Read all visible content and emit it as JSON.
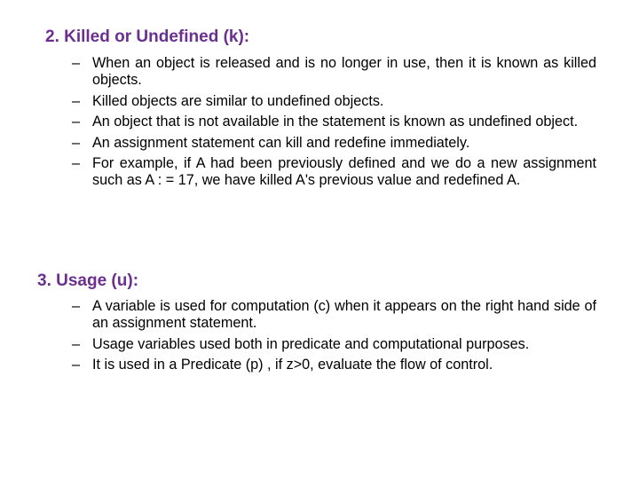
{
  "sections": [
    {
      "heading": "2. Killed or Undefined (k):",
      "bullet_glyph": "–",
      "items": [
        "When an object is released and is no longer in use, then it is known as killed objects.",
        "Killed objects are similar to undefined objects.",
        "An object that is not available in the statement is known as undefined object.",
        "An assignment statement can kill and redefine immediately.",
        "For example, if A had been previously defined and we do a new assignment such as A : = 17, we have killed A's previous value and redefined A."
      ]
    },
    {
      "heading": "3. Usage (u):",
      "bullet_glyph": "–",
      "items": [
        "A variable is used for computation (c) when it appears on the right hand side of an assignment statement.",
        "Usage variables used both in predicate and computational purposes.",
        "It is used in a Predicate (p) , if z>0, evaluate the flow of control."
      ]
    }
  ],
  "colors": {
    "heading": "#6a2f8f",
    "body": "#000000",
    "background": "#ffffff"
  }
}
